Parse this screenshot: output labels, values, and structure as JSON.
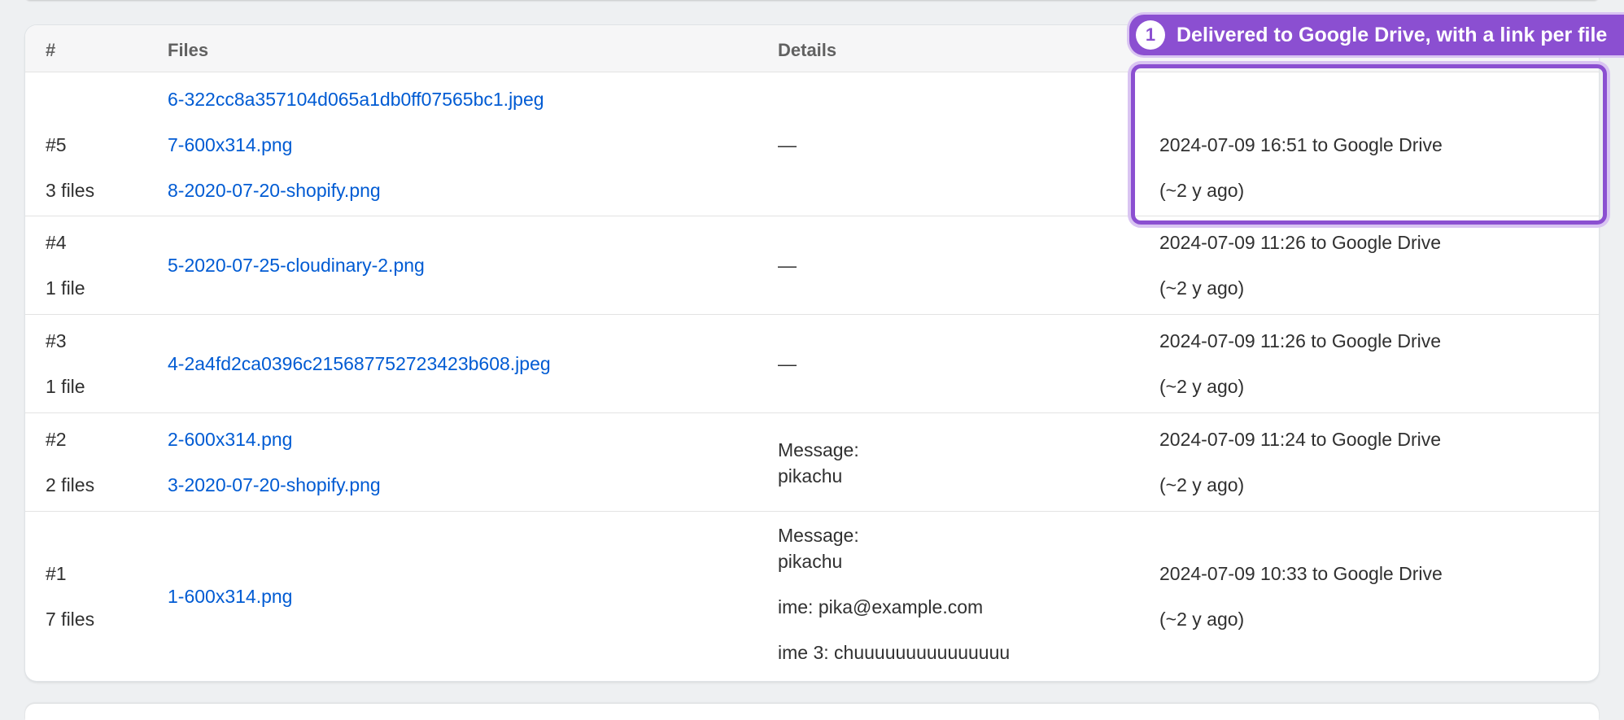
{
  "table": {
    "headers": {
      "num": "#",
      "files": "Files",
      "details": "Details"
    },
    "rows": [
      {
        "id": "#5",
        "count": "3 files",
        "files": [
          "6-322cc8a357104d065a1db0ff07565bc1.jpeg",
          "7-600x314.png",
          "8-2020-07-20-shopify.png"
        ],
        "details": "—",
        "delivered": "2024-07-09 16:51 to Google Drive",
        "ago": "(~2 y ago)"
      },
      {
        "id": "#4",
        "count": "1 file",
        "files": [
          "5-2020-07-25-cloudinary-2.png"
        ],
        "details": "—",
        "delivered": "2024-07-09 11:26 to Google Drive",
        "ago": "(~2 y ago)"
      },
      {
        "id": "#3",
        "count": "1 file",
        "files": [
          "4-2a4fd2ca0396c215687752723423b608.jpeg"
        ],
        "details": "—",
        "delivered": "2024-07-09 11:26 to Google Drive",
        "ago": "(~2 y ago)"
      },
      {
        "id": "#2",
        "count": "2 files",
        "files": [
          "2-600x314.png",
          "3-2020-07-20-shopify.png"
        ],
        "details_message_label": "Message:",
        "details_message_value": "pikachu",
        "delivered": "2024-07-09 11:24 to Google Drive",
        "ago": "(~2 y ago)"
      },
      {
        "id": "#1",
        "count": "7 files",
        "files": [
          "1-600x314.png"
        ],
        "details_message_label": "Message:",
        "details_message_value": "pikachu",
        "details_extra": [
          "ime: pika@example.com",
          "ime 3: chuuuuuuuuuuuuuuu"
        ],
        "delivered": "2024-07-09 10:33 to Google Drive",
        "ago": "(~2 y ago)"
      }
    ]
  },
  "callout": {
    "step": "1",
    "text": "Delivered to Google Drive, with a link per file"
  },
  "colors": {
    "accent": "#8b4fd1",
    "link": "#005bd3"
  }
}
